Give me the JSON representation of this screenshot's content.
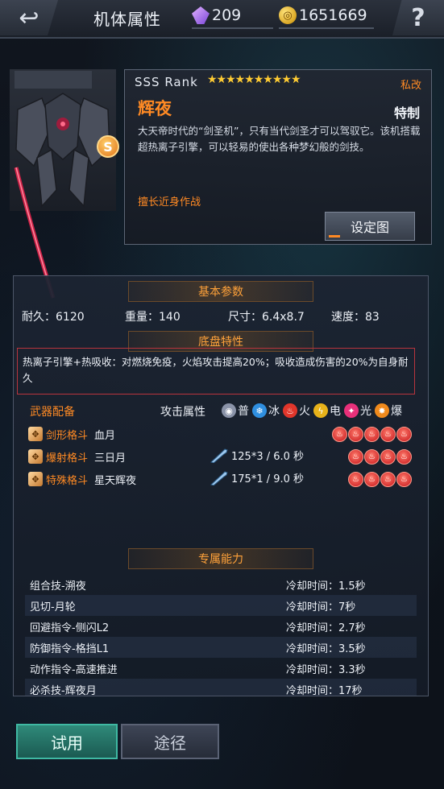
{
  "header": {
    "title": "机体属性",
    "crystals": "209",
    "gold": "1651669",
    "back_icon": "back-arrow-icon",
    "help_label": "?"
  },
  "mech": {
    "badge": "S",
    "rank": "SSS  Rank",
    "star_count": 10,
    "stars": "★★★★★★★★★★",
    "private_label": "私改",
    "name": "辉夜",
    "type": "特制",
    "description": "大天帝时代的“剑圣机”，只有当代剑圣才可以驾驭它。该机搭载超热离子引擎，可以轻易的使出各种梦幻般的剑技。",
    "specialty": "擅长近身作战",
    "setting_button": "设定图"
  },
  "basic_params": {
    "title": "基本参数",
    "durability": "耐久：6120",
    "weight": "重量：140",
    "size": "尺寸：6.4x8.7",
    "speed": "速度：83"
  },
  "chassis": {
    "title": "底盘特性",
    "text": "热离子引擎+热吸收：对燃烧免疫，火焰攻击提高20%；吸收造成伤害的20%为自身耐久"
  },
  "weapons": {
    "label": "武器配备",
    "attack_attr_label": "攻击属性",
    "elements": [
      {
        "name": "普",
        "color": "#8a93a8",
        "glyph": "◉"
      },
      {
        "name": "冰",
        "color": "#2f8fe0",
        "glyph": "❄"
      },
      {
        "name": "火",
        "color": "#e0362b",
        "glyph": "♨"
      },
      {
        "name": "电",
        "color": "#e8b31a",
        "glyph": "ϟ"
      },
      {
        "name": "光",
        "color": "#e8307a",
        "glyph": "✦"
      },
      {
        "name": "爆",
        "color": "#f08a1c",
        "glyph": "✸"
      }
    ],
    "items": [
      {
        "type": "剑形格斗",
        "name": "血月",
        "ammo": "",
        "fire": 5
      },
      {
        "type": "爆射格斗",
        "name": "三日月",
        "ammo": "125*3  / 6.0 秒",
        "fire": 4
      },
      {
        "type": "特殊格斗",
        "name": "星天辉夜",
        "ammo": "175*1  / 9.0 秒",
        "fire": 4
      }
    ]
  },
  "skills": {
    "title": "专属能力",
    "items": [
      {
        "name": "组合技-溯夜",
        "cooldown": "冷却时间：1.5秒"
      },
      {
        "name": "见切-月轮",
        "cooldown": "冷却时间：7秒"
      },
      {
        "name": "回避指令-侧闪L2",
        "cooldown": "冷却时间：2.7秒"
      },
      {
        "name": "防御指令-格挡L1",
        "cooldown": "冷却时间：3.5秒"
      },
      {
        "name": "动作指令-高速推进",
        "cooldown": "冷却时间：3.3秒"
      },
      {
        "name": "必杀技-辉夜月",
        "cooldown": "冷却时间：17秒"
      }
    ]
  },
  "buttons": {
    "trial": "试用",
    "route": "途径"
  },
  "colors": {
    "accent_orange": "#ff8a24",
    "trait_border": "#b9343d",
    "trial_green": "#2f8a7a"
  }
}
